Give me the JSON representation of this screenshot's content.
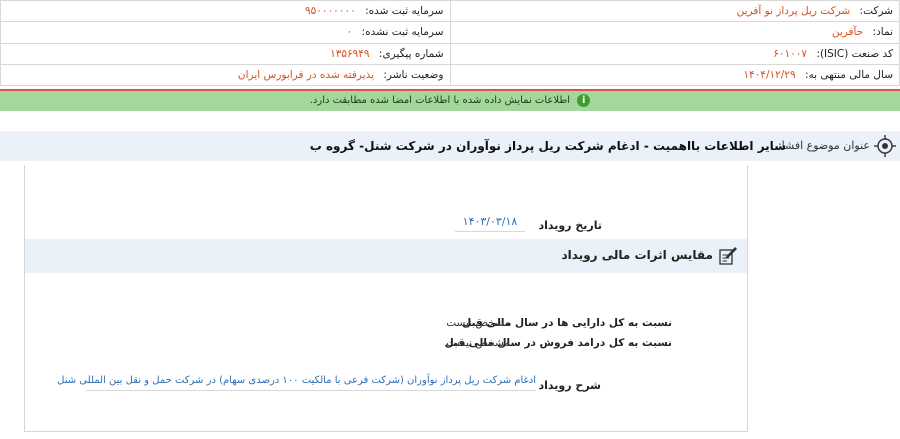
{
  "company_info": {
    "company_label": "شرکت:",
    "company_value": "شرکت ریل پرداز نو آفرین",
    "registered_capital_label": "سرمایه ثبت شده:",
    "registered_capital_value": "۹۵۰۰۰۰۰۰۰",
    "symbol_label": "نماد:",
    "symbol_value": "حآفرین",
    "unregistered_capital_label": "سرمایه ثبت نشده:",
    "unregistered_capital_value": "۰",
    "isic_label": "کد صنعت (ISIC):",
    "isic_value": "۶۰۱۰۰۷",
    "tracking_label": "شماره پیگیری:",
    "tracking_value": "۱۳۵۶۹۴۹",
    "fiscal_year_label": "سال مالی منتهی به:",
    "fiscal_year_value": "۱۴۰۴/۱۲/۲۹",
    "publisher_status_label": "وضعیت ناشر:",
    "publisher_status_value": "پذیرفته شده در فرابورس ایران"
  },
  "notice": {
    "text": "اطلاعات نمایش داده شده با اطلاعات امضا شده مطابقت دارد.",
    "icon": "info-icon"
  },
  "subject": {
    "label": "عنوان موضوع افشا:",
    "value": "سایر اطلاعات بااهمیت - ادغام شرکت ریل پرداز نوآوران در شرکت شنل- گروه ب",
    "icon": "target-icon"
  },
  "event": {
    "date_label": "تاریخ رویداد",
    "date_value": "۱۴۰۳/۰۳/۱۸",
    "compare_title": "مقایس اثرات مالی رویداد",
    "compare_icon": "edit-icon",
    "assets_label": "نسبت به کل دارایی ها در سال مالی قبل",
    "assets_value": "مشخص نیست",
    "revenue_label": "نسبت به کل درامد فروش در سال مالی قبل",
    "revenue_value": "مشخص نیست",
    "description_label": "شرح رویداد",
    "description_value": "ادغام شرکت ریل پرداز نوآوران (شرکت فرعی با مالکیت ۱۰۰ درصدی سهام) در شرکت حمل و نقل بین المللی شنل"
  },
  "colors": {
    "accent_value": "#d8501f",
    "link_blue": "#2e6fb4",
    "notice_bg": "#a4d79b",
    "alert_line": "#e05050",
    "section_bg": "#eaf1f8"
  }
}
